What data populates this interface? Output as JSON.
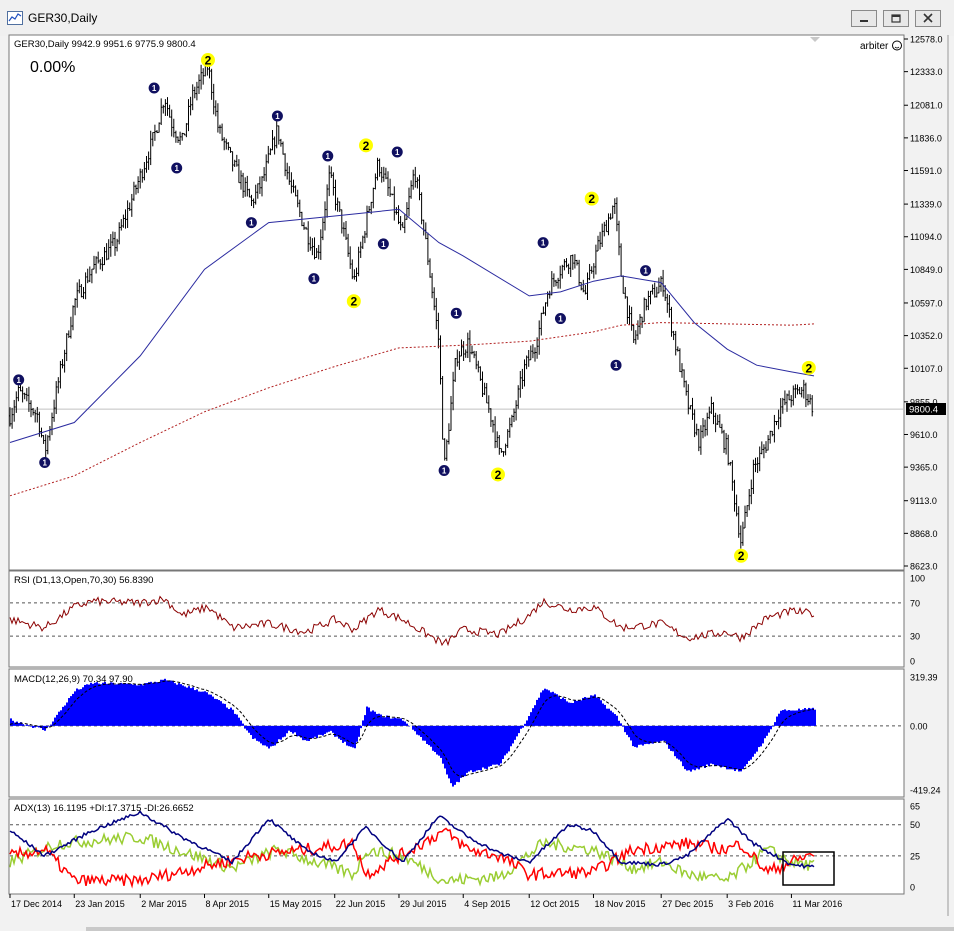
{
  "window": {
    "title": "GER30,Daily"
  },
  "main_panel": {
    "header": "GER30,Daily  9942.9 9951.6 9775.9 9800.4",
    "percent_label": "0.00%",
    "account_label": "arbiter",
    "price_tag": "9800.4",
    "price_ticks": [
      "12578.0",
      "12333.0",
      "12081.0",
      "11836.0",
      "11591.0",
      "11339.0",
      "11094.0",
      "10849.0",
      "10597.0",
      "10352.0",
      "10107.0",
      "9855.0",
      "9610.0",
      "9365.0",
      "9113.0",
      "8868.0",
      "8623.0"
    ]
  },
  "rsi_panel": {
    "header": "RSI (D1,13,Open,70,30) 56.8390",
    "ticks": [
      "100",
      "70",
      "30",
      "0"
    ]
  },
  "macd_panel": {
    "header": "MACD(12,26,9) 70.34 97.90",
    "ticks": [
      "319.39",
      "0.00",
      "-419.24"
    ]
  },
  "adx_panel": {
    "header": "ADX(13) 16.1195 +DI:17.3715 -DI:26.6652",
    "ticks": [
      "65",
      "50",
      "25",
      "0"
    ]
  },
  "x_axis_labels": [
    "17 Dec 2014",
    "23 Jan 2015",
    "2 Mar 2015",
    "8 Apr 2015",
    "15 May 2015",
    "22 Jun 2015",
    "29 Jul 2015",
    "4 Sep 2015",
    "12 Oct 2015",
    "18 Nov 2015",
    "27 Dec 2015",
    "3 Feb 2016",
    "11 Mar 2016"
  ],
  "colors": {
    "price_bars": "#000000",
    "ma_fast": "#2b2ba0",
    "ma_slow": "#b22222",
    "marker_blue": "#101060",
    "marker_yellow": "#ffff00",
    "rsi_line": "#8b0000",
    "rsi_line_high": "#00008b",
    "macd_hist": "#0000ff",
    "adx_main": "#000080",
    "adx_plus": "#9acd32",
    "adx_minus": "#ff0000"
  },
  "chart_data": {
    "type": "line",
    "symbol": "GER30",
    "timeframe": "Daily",
    "last_bar": {
      "open": 9942.9,
      "high": 9951.6,
      "low": 9775.9,
      "close": 9800.4
    },
    "ylim": [
      8623.0,
      12578.0
    ],
    "close_path": [
      [
        "17 Dec 2014",
        9750
      ],
      [
        "22 Dec 2014",
        9930
      ],
      [
        "2 Jan 2015",
        9750
      ],
      [
        "6 Jan 2015",
        9470
      ],
      [
        "13 Jan 2015",
        9950
      ],
      [
        "23 Jan 2015",
        10600
      ],
      [
        "2 Feb 2015",
        10850
      ],
      [
        "16 Feb 2015",
        11050
      ],
      [
        "2 Mar 2015",
        11550
      ],
      [
        "10 Mar 2015",
        11850
      ],
      [
        "16 Mar 2015",
        12150
      ],
      [
        "20 Mar 2015",
        11950
      ],
      [
        "26 Mar 2015",
        11800
      ],
      [
        "1 Apr 2015",
        12150
      ],
      [
        "10 Apr 2015",
        12380
      ],
      [
        "16 Apr 2015",
        11900
      ],
      [
        "24 Apr 2015",
        11650
      ],
      [
        "5 May 2015",
        11350
      ],
      [
        "11 May 2015",
        11500
      ],
      [
        "20 May 2015",
        11900
      ],
      [
        "27 May 2015",
        11500
      ],
      [
        "5 Jun 2015",
        11150
      ],
      [
        "12 Jun 2015",
        10950
      ],
      [
        "19 Jun 2015",
        11550
      ],
      [
        "26 Jun 2015",
        11200
      ],
      [
        "3 Jul 2015",
        10750
      ],
      [
        "10 Jul 2015",
        11200
      ],
      [
        "17 Jul 2015",
        11650
      ],
      [
        "24 Jul 2015",
        11400
      ],
      [
        "31 Jul 2015",
        11100
      ],
      [
        "7 Aug 2015",
        11600
      ],
      [
        "14 Aug 2015",
        11000
      ],
      [
        "21 Aug 2015",
        10300
      ],
      [
        "24 Aug 2015",
        9350
      ],
      [
        "31 Aug 2015",
        10200
      ],
      [
        "7 Sep 2015",
        10300
      ],
      [
        "14 Sep 2015",
        10000
      ],
      [
        "21 Sep 2015",
        9700
      ],
      [
        "25 Sep 2015",
        9450
      ],
      [
        "2 Oct 2015",
        9700
      ],
      [
        "9 Oct 2015",
        10100
      ],
      [
        "16 Oct 2015",
        10300
      ],
      [
        "23 Oct 2015",
        10700
      ],
      [
        "30 Oct 2015",
        10850
      ],
      [
        "6 Nov 2015",
        10950
      ],
      [
        "13 Nov 2015",
        10650
      ],
      [
        "20 Nov 2015",
        11000
      ],
      [
        "30 Nov 2015",
        11350
      ],
      [
        "4 Dec 2015",
        10800
      ],
      [
        "11 Dec 2015",
        10300
      ],
      [
        "18 Dec 2015",
        10600
      ],
      [
        "28 Dec 2015",
        10750
      ],
      [
        "4 Jan 2016",
        10300
      ],
      [
        "11 Jan 2016",
        9850
      ],
      [
        "18 Jan 2016",
        9550
      ],
      [
        "25 Jan 2016",
        9800
      ],
      [
        "3 Feb 2016",
        9500
      ],
      [
        "11 Feb 2016",
        8800
      ],
      [
        "18 Feb 2016",
        9350
      ],
      [
        "26 Feb 2016",
        9550
      ],
      [
        "4 Mar 2016",
        9800
      ],
      [
        "11 Mar 2016",
        9900
      ],
      [
        "18 Mar 2016",
        9950
      ],
      [
        "24 Mar 2016",
        9800
      ]
    ],
    "ma_fast_path": [
      [
        "17 Dec 2014",
        9550
      ],
      [
        "23 Jan 2015",
        9700
      ],
      [
        "2 Mar 2015",
        10200
      ],
      [
        "8 Apr 2015",
        10850
      ],
      [
        "15 May 2015",
        11200
      ],
      [
        "22 Jun 2015",
        11250
      ],
      [
        "29 Jul 2015",
        11300
      ],
      [
        "21 Aug 2015",
        11050
      ],
      [
        "4 Sep 2015",
        10950
      ],
      [
        "12 Oct 2015",
        10650
      ],
      [
        "30 Oct 2015",
        10680
      ],
      [
        "18 Nov 2015",
        10760
      ],
      [
        "4 Dec 2015",
        10800
      ],
      [
        "27 Dec 2015",
        10750
      ],
      [
        "15 Jan 2016",
        10450
      ],
      [
        "3 Feb 2016",
        10250
      ],
      [
        "20 Feb 2016",
        10130
      ],
      [
        "11 Mar 2016",
        10080
      ],
      [
        "24 Mar 2016",
        10050
      ]
    ],
    "ma_slow_path": [
      [
        "17 Dec 2014",
        9150
      ],
      [
        "23 Jan 2015",
        9300
      ],
      [
        "2 Mar 2015",
        9550
      ],
      [
        "8 Apr 2015",
        9780
      ],
      [
        "15 May 2015",
        9960
      ],
      [
        "22 Jun 2015",
        10120
      ],
      [
        "29 Jul 2015",
        10260
      ],
      [
        "4 Sep 2015",
        10280
      ],
      [
        "12 Oct 2015",
        10310
      ],
      [
        "18 Nov 2015",
        10380
      ],
      [
        "4 Dec 2015",
        10430
      ],
      [
        "27 Dec 2015",
        10450
      ],
      [
        "3 Feb 2016",
        10440
      ],
      [
        "11 Mar 2016",
        10430
      ],
      [
        "24 Mar 2016",
        10440
      ]
    ],
    "markers": [
      {
        "date": "22 Dec 2014",
        "price": 10020,
        "label": "1",
        "style": "blue"
      },
      {
        "date": "6 Jan 2015",
        "price": 9400,
        "label": "1",
        "style": "blue"
      },
      {
        "date": "10 Mar 2015",
        "price": 12210,
        "label": "1",
        "style": "blue"
      },
      {
        "date": "23 Mar 2015",
        "price": 11610,
        "label": "1",
        "style": "blue"
      },
      {
        "date": "10 Apr 2015",
        "price": 12420,
        "label": "2",
        "style": "yellow"
      },
      {
        "date": "5 May 2015",
        "price": 11200,
        "label": "1",
        "style": "blue"
      },
      {
        "date": "20 May 2015",
        "price": 12000,
        "label": "1",
        "style": "blue"
      },
      {
        "date": "10 Jun 2015",
        "price": 10780,
        "label": "1",
        "style": "blue"
      },
      {
        "date": "18 Jun 2015",
        "price": 11700,
        "label": "1",
        "style": "blue"
      },
      {
        "date": "3 Jul 2015",
        "price": 10610,
        "label": "2",
        "style": "yellow"
      },
      {
        "date": "10 Jul 2015",
        "price": 11780,
        "label": "2",
        "style": "yellow"
      },
      {
        "date": "20 Jul 2015",
        "price": 11040,
        "label": "1",
        "style": "blue"
      },
      {
        "date": "28 Jul 2015",
        "price": 11730,
        "label": "1",
        "style": "blue"
      },
      {
        "date": "24 Aug 2015",
        "price": 9340,
        "label": "1",
        "style": "blue"
      },
      {
        "date": "31 Aug 2015",
        "price": 10520,
        "label": "1",
        "style": "blue"
      },
      {
        "date": "24 Sep 2015",
        "price": 9310,
        "label": "2",
        "style": "yellow"
      },
      {
        "date": "20 Oct 2015",
        "price": 11050,
        "label": "1",
        "style": "blue"
      },
      {
        "date": "30 Oct 2015",
        "price": 10480,
        "label": "1",
        "style": "blue"
      },
      {
        "date": "17 Nov 2015",
        "price": 11380,
        "label": "2",
        "style": "yellow"
      },
      {
        "date": "1 Dec 2015",
        "price": 10130,
        "label": "1",
        "style": "blue"
      },
      {
        "date": "18 Dec 2015",
        "price": 10840,
        "label": "1",
        "style": "blue"
      },
      {
        "date": "11 Feb 2016",
        "price": 8700,
        "label": "2",
        "style": "yellow"
      },
      {
        "date": "21 Mar 2016",
        "price": 10110,
        "label": "2",
        "style": "yellow"
      }
    ],
    "rsi": {
      "levels": [
        70,
        30
      ],
      "ylim": [
        0,
        100
      ],
      "path": [
        [
          "17 Dec 2014",
          50
        ],
        [
          "6 Jan 2015",
          40
        ],
        [
          "23 Jan 2015",
          65
        ],
        [
          "2 Feb 2015",
          72
        ],
        [
          "2 Mar 2015",
          70
        ],
        [
          "16 Mar 2015",
          75
        ],
        [
          "26 Mar 2015",
          55
        ],
        [
          "10 Apr 2015",
          65
        ],
        [
          "24 Apr 2015",
          40
        ],
        [
          "15 May 2015",
          45
        ],
        [
          "5 Jun 2015",
          35
        ],
        [
          "22 Jun 2015",
          50
        ],
        [
          "3 Jul 2015",
          38
        ],
        [
          "17 Jul 2015",
          62
        ],
        [
          "31 Jul 2015",
          50
        ],
        [
          "24 Aug 2015",
          20
        ],
        [
          "4 Sep 2015",
          38
        ],
        [
          "25 Sep 2015",
          32
        ],
        [
          "12 Oct 2015",
          55
        ],
        [
          "20 Oct 2015",
          72
        ],
        [
          "4 Nov 2015",
          62
        ],
        [
          "18 Nov 2015",
          65
        ],
        [
          "4 Dec 2015",
          40
        ],
        [
          "27 Dec 2015",
          45
        ],
        [
          "11 Jan 2016",
          28
        ],
        [
          "3 Feb 2016",
          35
        ],
        [
          "11 Feb 2016",
          28
        ],
        [
          "26 Feb 2016",
          52
        ],
        [
          "11 Mar 2016",
          60
        ],
        [
          "24 Mar 2016",
          57
        ]
      ]
    },
    "macd": {
      "ylim": [
        -419.24,
        319.39
      ],
      "hist": [
        [
          "17 Dec 2014",
          40
        ],
        [
          "6 Jan 2015",
          -30
        ],
        [
          "23 Jan 2015",
          230
        ],
        [
          "2 Feb 2015",
          280
        ],
        [
          "2 Mar 2015",
          270
        ],
        [
          "16 Mar 2015",
          300
        ],
        [
          "8 Apr 2015",
          220
        ],
        [
          "24 Apr 2015",
          100
        ],
        [
          "5 May 2015",
          -80
        ],
        [
          "15 May 2015",
          -150
        ],
        [
          "27 May 2015",
          -30
        ],
        [
          "5 Jun 2015",
          -100
        ],
        [
          "19 Jun 2015",
          -40
        ],
        [
          "3 Jul 2015",
          -160
        ],
        [
          "10 Jul 2015",
          120
        ],
        [
          "17 Jul 2015",
          70
        ],
        [
          "31 Jul 2015",
          40
        ],
        [
          "21 Aug 2015",
          -200
        ],
        [
          "28 Aug 2015",
          -400
        ],
        [
          "7 Sep 2015",
          -300
        ],
        [
          "25 Sep 2015",
          -250
        ],
        [
          "9 Oct 2015",
          20
        ],
        [
          "20 Oct 2015",
          250
        ],
        [
          "4 Nov 2015",
          150
        ],
        [
          "18 Nov 2015",
          200
        ],
        [
          "1 Dec 2015",
          60
        ],
        [
          "11 Dec 2015",
          -140
        ],
        [
          "28 Dec 2015",
          -100
        ],
        [
          "11 Jan 2016",
          -300
        ],
        [
          "25 Jan 2016",
          -250
        ],
        [
          "11 Feb 2016",
          -300
        ],
        [
          "26 Feb 2016",
          -60
        ],
        [
          "4 Mar 2016",
          100
        ],
        [
          "24 Mar 2016",
          110
        ]
      ]
    },
    "adx": {
      "levels": [
        50,
        25
      ],
      "ylim": [
        0,
        65
      ],
      "adx_path": [
        [
          "17 Dec 2014",
          45
        ],
        [
          "6 Jan 2015",
          25
        ],
        [
          "2 Feb 2015",
          45
        ],
        [
          "2 Mar 2015",
          60
        ],
        [
          "26 Mar 2015",
          40
        ],
        [
          "24 Apr 2015",
          20
        ],
        [
          "15 May 2015",
          55
        ],
        [
          "5 Jun 2015",
          30
        ],
        [
          "22 Jun 2015",
          20
        ],
        [
          "10 Jul 2015",
          48
        ],
        [
          "31 Jul 2015",
          20
        ],
        [
          "21 Aug 2015",
          57
        ],
        [
          "7 Sep 2015",
          40
        ],
        [
          "25 Sep 2015",
          27
        ],
        [
          "12 Oct 2015",
          20
        ],
        [
          "4 Nov 2015",
          50
        ],
        [
          "18 Nov 2015",
          45
        ],
        [
          "4 Dec 2015",
          20
        ],
        [
          "27 Dec 2015",
          18
        ],
        [
          "11 Jan 2016",
          25
        ],
        [
          "3 Feb 2016",
          55
        ],
        [
          "18 Feb 2016",
          35
        ],
        [
          "11 Mar 2016",
          18
        ],
        [
          "24 Mar 2016",
          16
        ]
      ],
      "plus_di_path": [
        [
          "17 Dec 2014",
          20
        ],
        [
          "13 Jan 2015",
          35
        ],
        [
          "2 Mar 2015",
          40
        ],
        [
          "24 Apr 2015",
          15
        ],
        [
          "20 May 2015",
          30
        ],
        [
          "3 Jul 2015",
          10
        ],
        [
          "10 Jul 2015",
          30
        ],
        [
          "31 Jul 2015",
          25
        ],
        [
          "24 Aug 2015",
          5
        ],
        [
          "25 Sep 2015",
          8
        ],
        [
          "20 Oct 2015",
          35
        ],
        [
          "18 Nov 2015",
          30
        ],
        [
          "11 Dec 2015",
          15
        ],
        [
          "28 Dec 2015",
          20
        ],
        [
          "11 Jan 2016",
          10
        ],
        [
          "3 Feb 2016",
          5
        ],
        [
          "26 Feb 2016",
          30
        ],
        [
          "11 Mar 2016",
          20
        ],
        [
          "24 Mar 2016",
          17
        ]
      ],
      "minus_di_path": [
        [
          "17 Dec 2014",
          25
        ],
        [
          "6 Jan 2015",
          30
        ],
        [
          "23 Jan 2015",
          5
        ],
        [
          "2 Mar 2015",
          5
        ],
        [
          "5 May 2015",
          25
        ],
        [
          "5 Jun 2015",
          30
        ],
        [
          "3 Jul 2015",
          35
        ],
        [
          "10 Jul 2015",
          10
        ],
        [
          "24 Aug 2015",
          45
        ],
        [
          "7 Sep 2015",
          30
        ],
        [
          "25 Sep 2015",
          25
        ],
        [
          "12 Oct 2015",
          10
        ],
        [
          "18 Nov 2015",
          12
        ],
        [
          "11 Dec 2015",
          30
        ],
        [
          "11 Jan 2016",
          35
        ],
        [
          "3 Feb 2016",
          30
        ],
        [
          "11 Feb 2016",
          35
        ],
        [
          "26 Feb 2016",
          12
        ],
        [
          "11 Mar 2016",
          20
        ],
        [
          "24 Mar 2016",
          27
        ]
      ]
    }
  }
}
